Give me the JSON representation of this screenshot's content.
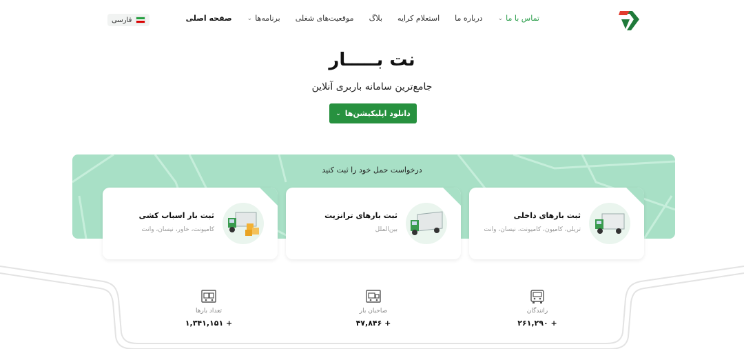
{
  "header": {
    "nav": [
      {
        "label": "صفحه اصلی",
        "active": true,
        "dropdown": false
      },
      {
        "label": "برنامه‌ها",
        "dropdown": true
      },
      {
        "label": "موقعیت‌های شغلی",
        "dropdown": false
      },
      {
        "label": "بلاگ",
        "dropdown": false
      },
      {
        "label": "استعلام کرایه",
        "dropdown": false
      },
      {
        "label": "درباره ما",
        "dropdown": false
      },
      {
        "label": "تماس با ما",
        "dropdown": true
      }
    ],
    "language": "فارسی"
  },
  "hero": {
    "title": "نت بـــــار",
    "subtitle": "جامع‌ترین سامانه باربری آنلاین",
    "download_label": "دانلود اپلیکیشن‌ها"
  },
  "request": {
    "title": "درخواست حمل خود را ثبت کنید",
    "cards": [
      {
        "title": "ثبت بارهای داخلی",
        "subtitle": "تریلی، کامیون، کامیونت، نیسان، وانت",
        "icon": "truck-icon"
      },
      {
        "title": "ثبت بارهای ترانزیت",
        "subtitle": "بین‌الملل",
        "icon": "transit-truck-icon"
      },
      {
        "title": "ثبت بار اسباب کشی",
        "subtitle": "کامیونت، خاور، نیسان، وانت",
        "icon": "moving-truck-icon"
      }
    ]
  },
  "stats": [
    {
      "label": "رانندگان",
      "value": "+ ۲۶۱,۲۹۰",
      "icon": "driver-truck-icon"
    },
    {
      "label": "صاحبان بار",
      "value": "+ ۴۷,۸۴۶",
      "icon": "cargo-owner-icon"
    },
    {
      "label": "تعداد بارها",
      "value": "+ ۱,۳۴۱,۱۵۱",
      "icon": "cargo-count-icon"
    }
  ],
  "colors": {
    "brand_green": "#27913f",
    "panel_green": "#a8e0c6",
    "accent_red": "#e23b2e"
  }
}
